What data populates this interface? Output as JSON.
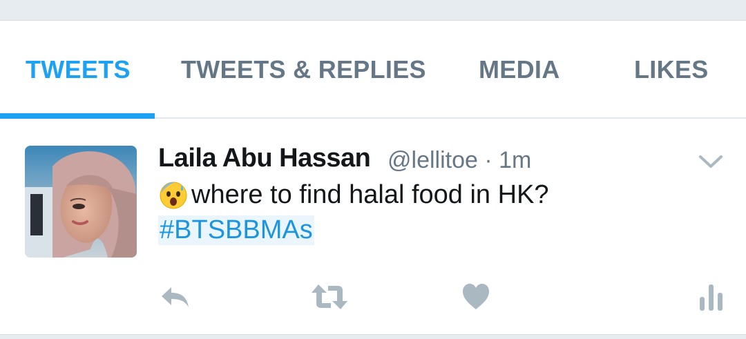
{
  "tabs": [
    {
      "label": "TWEETS",
      "active": true
    },
    {
      "label": "TWEETS & REPLIES",
      "active": false
    },
    {
      "label": "MEDIA",
      "active": false
    },
    {
      "label": "LIKES",
      "active": false
    }
  ],
  "tweet": {
    "author_name": "Laila Abu Hassan",
    "handle": "@lellitoe",
    "separator": "·",
    "time": "1m",
    "text": "where to find halal food in HK?",
    "emoji": "anxious-face-with-sweat",
    "hashtag": "#BTSBBMAs",
    "actions": [
      "reply-icon",
      "retweet-icon",
      "like-icon",
      "analytics-icon"
    ]
  },
  "colors": {
    "accent": "#1da1f2",
    "hashtag": "#1b95e0",
    "muted": "#657786",
    "icon": "#aab8c2",
    "text": "#14171a"
  }
}
